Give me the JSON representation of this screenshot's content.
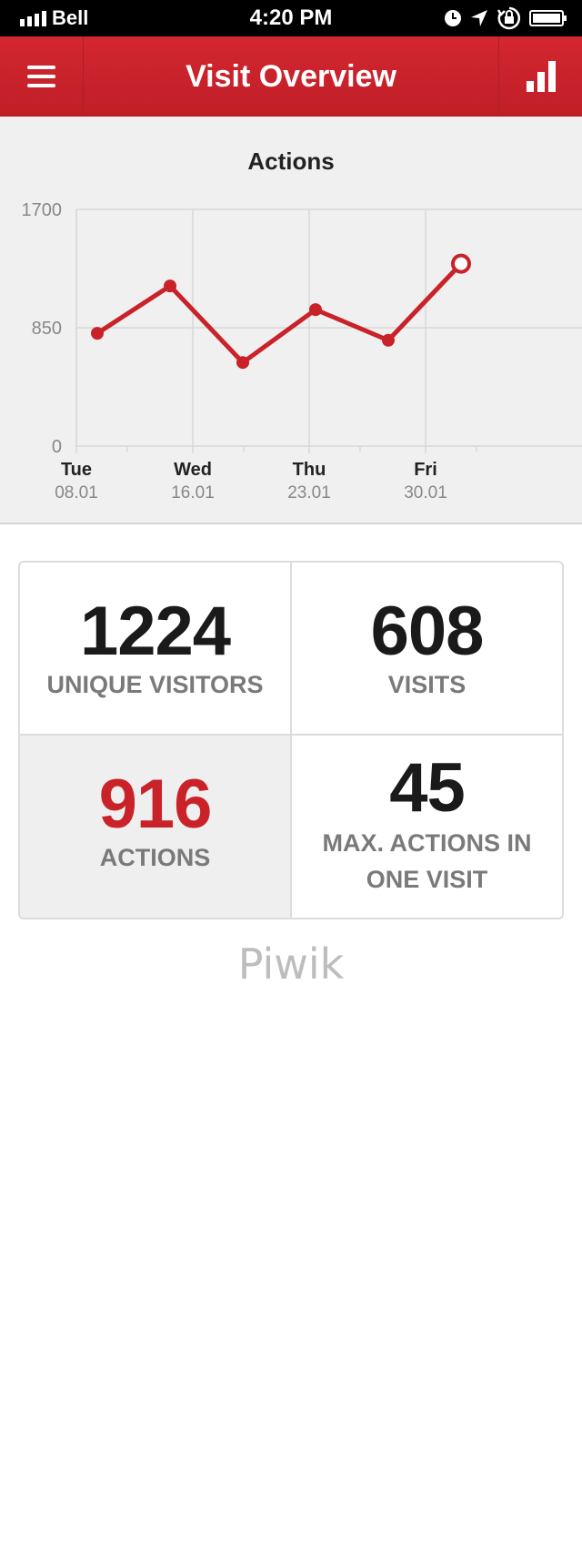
{
  "status_bar": {
    "carrier": "Bell",
    "time": "4:20 PM",
    "icons": [
      "signal-icon",
      "clock-icon",
      "location-arrow-icon",
      "rotation-lock-icon",
      "battery-icon"
    ]
  },
  "nav": {
    "title": "Visit Overview",
    "menu_icon": "hamburger-menu-icon",
    "chart_icon": "bar-chart-icon"
  },
  "chart_data": {
    "type": "line",
    "title": "Actions",
    "xlabel": "",
    "ylabel": "",
    "ylim": [
      0,
      1700
    ],
    "y_ticks": [
      0,
      850,
      1700
    ],
    "x_tick_labels": [
      {
        "day": "Tue",
        "date": "08.01"
      },
      {
        "day": "Wed",
        "date": "16.01"
      },
      {
        "day": "Thu",
        "date": "23.01"
      },
      {
        "day": "Fri",
        "date": "30.01"
      }
    ],
    "x": [
      "09.01",
      "14.01",
      "19.01",
      "24.01",
      "29.01",
      "02.02"
    ],
    "series": [
      {
        "values": [
          810,
          1150,
          600,
          980,
          760,
          1310
        ],
        "color": "#c92229"
      }
    ],
    "grid": true,
    "legend": "none"
  },
  "stats": [
    {
      "value": "1224",
      "label": "UNIQUE VISITORS"
    },
    {
      "value": "608",
      "label": "VISITS"
    },
    {
      "value": "916",
      "label": "ACTIONS"
    },
    {
      "value": "45",
      "label_line1": "MAX. ACTIONS IN",
      "label_line2": "ONE VISIT"
    }
  ],
  "footer": {
    "brand": "Piwik"
  },
  "colors": {
    "accent": "#c92229",
    "panel": "#f0f0f0"
  }
}
